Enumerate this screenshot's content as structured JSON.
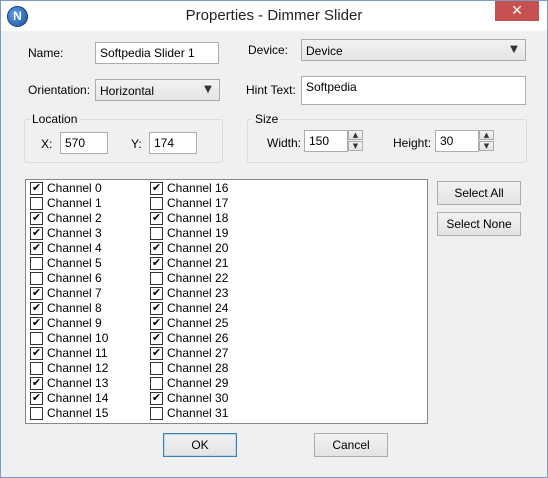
{
  "window": {
    "title": "Properties - Dimmer Slider",
    "close_glyph": "✕",
    "app_icon_letter": "N"
  },
  "form": {
    "name_label": "Name:",
    "name_value": "Softpedia Slider 1",
    "device_label": "Device:",
    "device_value": "Device",
    "orientation_label": "Orientation:",
    "orientation_value": "Horizontal",
    "hint_label": "Hint Text:",
    "hint_value": "Softpedia"
  },
  "location": {
    "group_label": "Location",
    "x_label": "X:",
    "x_value": "570",
    "y_label": "Y:",
    "y_value": "174"
  },
  "size": {
    "group_label": "Size",
    "width_label": "Width:",
    "width_value": "150",
    "height_label": "Height:",
    "height_value": "30"
  },
  "channels": [
    {
      "label": "Channel 0",
      "checked": true
    },
    {
      "label": "Channel 1",
      "checked": false
    },
    {
      "label": "Channel 2",
      "checked": true
    },
    {
      "label": "Channel 3",
      "checked": true
    },
    {
      "label": "Channel 4",
      "checked": true
    },
    {
      "label": "Channel 5",
      "checked": false
    },
    {
      "label": "Channel 6",
      "checked": false
    },
    {
      "label": "Channel 7",
      "checked": true
    },
    {
      "label": "Channel 8",
      "checked": true
    },
    {
      "label": "Channel 9",
      "checked": true
    },
    {
      "label": "Channel 10",
      "checked": false
    },
    {
      "label": "Channel 11",
      "checked": true
    },
    {
      "label": "Channel 12",
      "checked": false
    },
    {
      "label": "Channel 13",
      "checked": true
    },
    {
      "label": "Channel 14",
      "checked": true
    },
    {
      "label": "Channel 15",
      "checked": false
    },
    {
      "label": "Channel 16",
      "checked": true
    },
    {
      "label": "Channel 17",
      "checked": false
    },
    {
      "label": "Channel 18",
      "checked": true
    },
    {
      "label": "Channel 19",
      "checked": false
    },
    {
      "label": "Channel 20",
      "checked": true
    },
    {
      "label": "Channel 21",
      "checked": true
    },
    {
      "label": "Channel 22",
      "checked": false
    },
    {
      "label": "Channel 23",
      "checked": true
    },
    {
      "label": "Channel 24",
      "checked": true
    },
    {
      "label": "Channel 25",
      "checked": true
    },
    {
      "label": "Channel 26",
      "checked": true
    },
    {
      "label": "Channel 27",
      "checked": true
    },
    {
      "label": "Channel 28",
      "checked": false
    },
    {
      "label": "Channel 29",
      "checked": false
    },
    {
      "label": "Channel 30",
      "checked": true
    },
    {
      "label": "Channel 31",
      "checked": false
    }
  ],
  "buttons": {
    "select_all": "Select All",
    "select_none": "Select None",
    "ok": "OK",
    "cancel": "Cancel"
  },
  "icons": {
    "dropdown": "chevron-down-icon",
    "spin_up": "spin-up-icon",
    "spin_down": "spin-down-icon",
    "check": "checkmark-icon"
  }
}
